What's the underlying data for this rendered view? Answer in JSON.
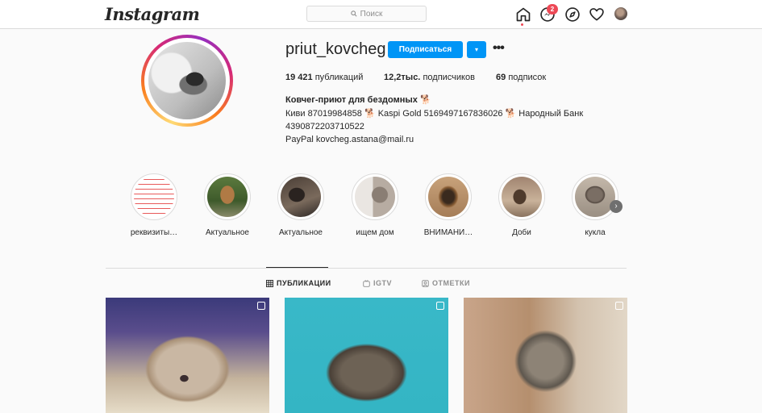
{
  "nav": {
    "logo": "Instagram",
    "search_placeholder": "Поиск",
    "messages_badge": "2",
    "icons": [
      "home-icon",
      "messenger-icon",
      "explore-icon",
      "heart-icon",
      "profile-avatar"
    ]
  },
  "profile": {
    "username": "priut_kovcheg",
    "follow_label": "Подписаться",
    "dropdown_label": "▾",
    "more_label": "•••",
    "stats": {
      "posts_num": "19 421",
      "posts_label": "публикаций",
      "followers_num": "12,2тыс.",
      "followers_label": "подписчиков",
      "following_num": "69",
      "following_label": "подписок"
    },
    "bio": {
      "name": "Ковчег-приют для бездомных 🐕",
      "line1": "Киви 87019984858 🐕 Kaspi Gold 5169497167836026 🐕 Народный Банк",
      "line2": "4390872203710522",
      "line3": "PayPal kovcheg.astana@mail.ru"
    }
  },
  "highlights": [
    {
      "label": "реквизиты…"
    },
    {
      "label": "Актуальное"
    },
    {
      "label": "Актуальное"
    },
    {
      "label": "ищем дом"
    },
    {
      "label": "ВНИМАНИ…"
    },
    {
      "label": "Доби"
    },
    {
      "label": "кукла"
    }
  ],
  "tabs": [
    {
      "label": "ПУБЛИКАЦИИ",
      "active": true
    },
    {
      "label": "IGTV",
      "active": false
    },
    {
      "label": "ОТМЕТКИ",
      "active": false
    }
  ],
  "colors": {
    "accent": "#0095f6",
    "badge": "#ed4956",
    "text": "#262626",
    "muted": "#8e8e8e",
    "border": "#dbdbdb"
  }
}
